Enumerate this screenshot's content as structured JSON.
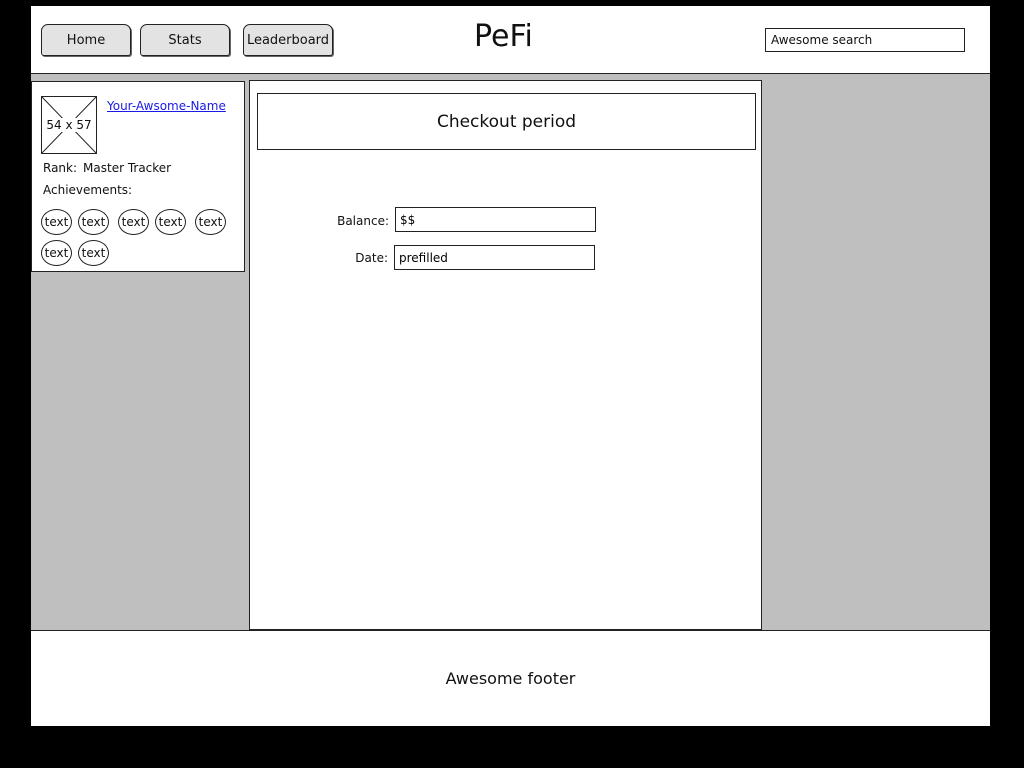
{
  "nav": {
    "tabs": [
      {
        "label": "Home"
      },
      {
        "label": "Stats"
      },
      {
        "label": "Leaderboard"
      }
    ],
    "brand": "PeFi",
    "search_placeholder": "Awesome search"
  },
  "profile": {
    "avatar_label": "54 x 57",
    "username": "Your-Awsome-Name",
    "rank_label": "Rank:",
    "rank_value": "Master Tracker",
    "achievements_label": "Achievements:",
    "achievements": [
      "text",
      "text",
      "text",
      "text",
      "text",
      "text",
      "text"
    ]
  },
  "main": {
    "title": "Checkout period",
    "fields": [
      {
        "label": "Balance:",
        "value": "$$"
      },
      {
        "label": "Date:",
        "value": "prefilled"
      }
    ]
  },
  "footer": {
    "text": "Awesome footer"
  }
}
